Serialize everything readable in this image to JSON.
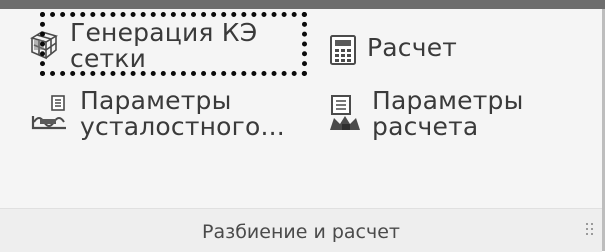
{
  "group": {
    "title": "Разбиение и расчет",
    "buttons": {
      "mesh": {
        "line1": "Генерация КЭ",
        "line2": "сетки",
        "icon": "mesh-cube-icon"
      },
      "calc": {
        "line1": "Расчет",
        "icon": "calculator-icon"
      },
      "fatigue": {
        "line1": "Параметры",
        "line2": "усталостного...",
        "icon": "fatigue-chart-icon"
      },
      "params": {
        "line1": "Параметры",
        "line2": "расчета",
        "icon": "analysis-settings-icon"
      }
    }
  },
  "colors": {
    "text": "#3a3a3a",
    "top_bar": "#6d6d6d",
    "ribbon_bg": "#f5f5f5",
    "footer_bg": "#eeeeee",
    "focus_ring": "#0b0b0b"
  }
}
